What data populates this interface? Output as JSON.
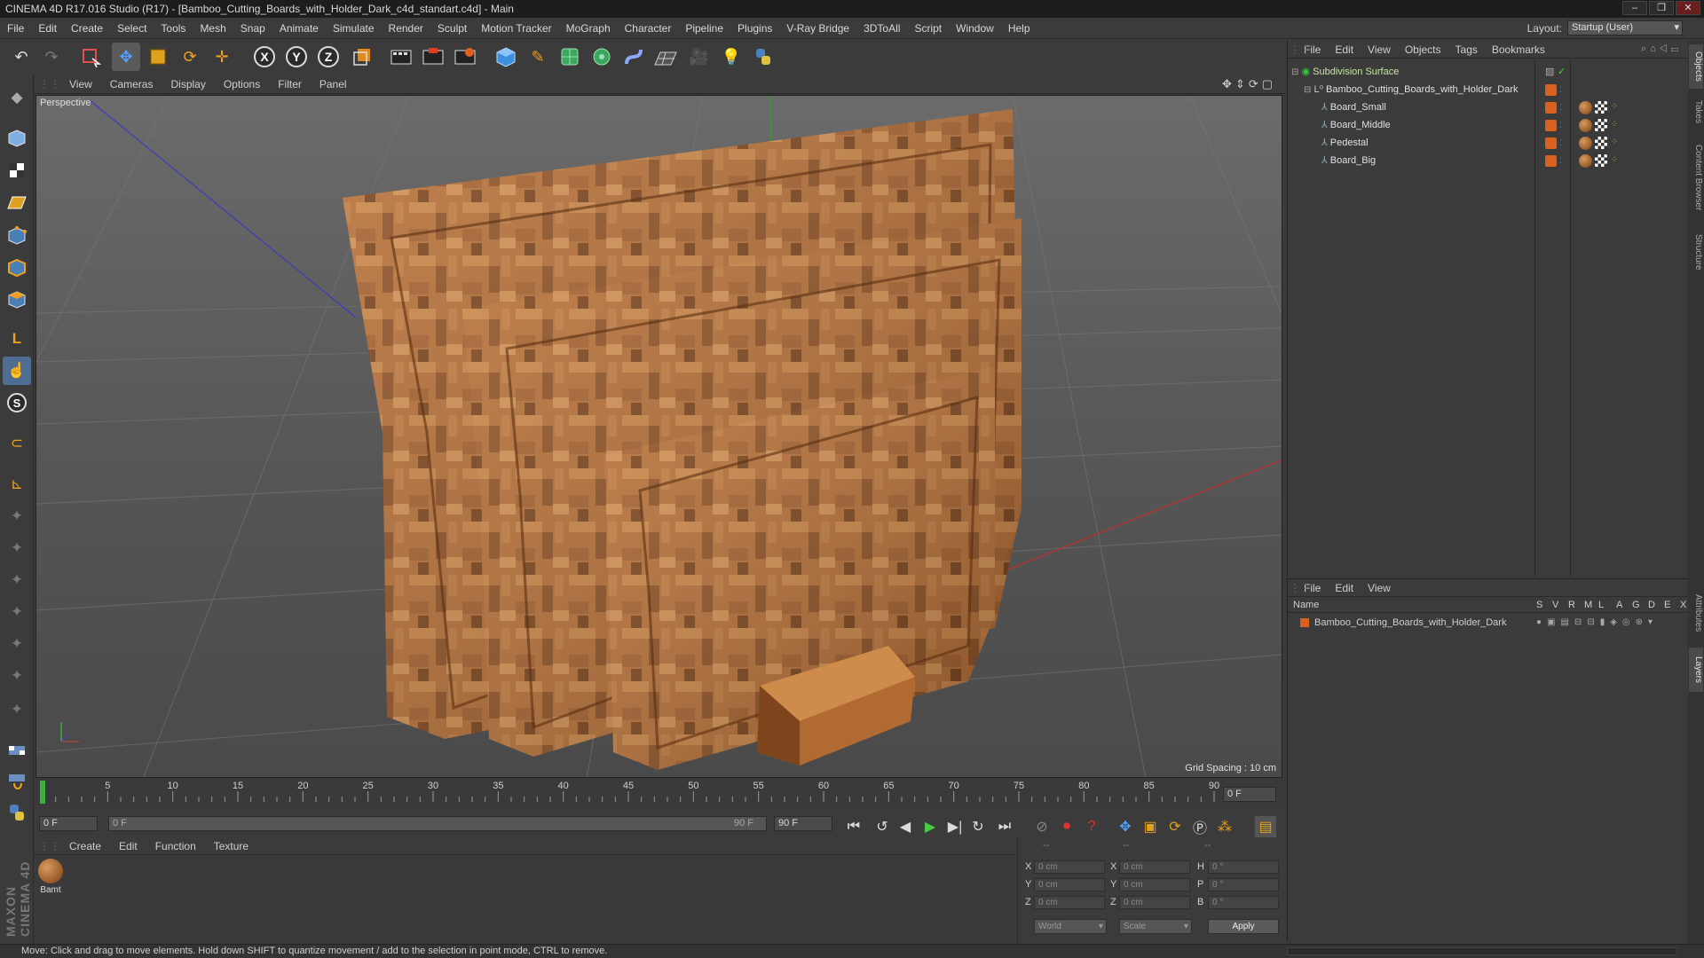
{
  "window": {
    "title": "CINEMA 4D R17.016 Studio (R17) - [Bamboo_Cutting_Boards_with_Holder_Dark_c4d_standart.c4d] - Main",
    "controls": [
      "–",
      "❐",
      "✕"
    ]
  },
  "menubar": {
    "items": [
      "File",
      "Edit",
      "Create",
      "Select",
      "Tools",
      "Mesh",
      "Snap",
      "Animate",
      "Simulate",
      "Render",
      "Sculpt",
      "Motion Tracker",
      "MoGraph",
      "Character",
      "Pipeline",
      "Plugins",
      "V-Ray Bridge",
      "3DToAll",
      "Script",
      "Window",
      "Help"
    ],
    "layout_label": "Layout:",
    "layout_value": "Startup (User)"
  },
  "toolbar": {
    "icons": [
      "undo-icon",
      "redo-icon",
      "live-selection-icon",
      "move-icon",
      "scale-icon",
      "rotate-icon",
      "transform-icon",
      "x-axis-icon",
      "y-axis-icon",
      "z-axis-icon",
      "coordinate-system-icon",
      "render-view-icon",
      "render-picture-viewer-icon",
      "edit-render-settings-icon",
      "cube-icon",
      "pen-icon",
      "subdivision-icon",
      "cloner-icon",
      "deformer-icon",
      "floor-icon",
      "camera-icon",
      "light-icon",
      "python-icon"
    ],
    "axis_labels": [
      "X",
      "Y",
      "Z"
    ]
  },
  "viewport": {
    "menu": [
      "View",
      "Cameras",
      "Display",
      "Options",
      "Filter",
      "Panel"
    ],
    "label": "Perspective",
    "grid_spacing": "Grid Spacing : 10 cm"
  },
  "timeline": {
    "ticks": [
      "0",
      "5",
      "10",
      "15",
      "20",
      "25",
      "30",
      "35",
      "40",
      "45",
      "50",
      "55",
      "60",
      "65",
      "70",
      "75",
      "80",
      "85",
      "90"
    ],
    "current_frame": "0 F",
    "start_field": "0 F",
    "range_start": "0 F",
    "range_end": "90 F",
    "end_field": "90 F"
  },
  "material_manager": {
    "menu": [
      "Create",
      "Edit",
      "Function",
      "Texture"
    ],
    "material_label": "Bamt"
  },
  "coordinates": {
    "headers": [
      "--",
      "--",
      "--"
    ],
    "rows": [
      {
        "a": "X",
        "av": "0 cm",
        "b": "X",
        "bv": "0 cm",
        "c": "H",
        "cv": "0 °"
      },
      {
        "a": "Y",
        "av": "0 cm",
        "b": "Y",
        "bv": "0 cm",
        "c": "P",
        "cv": "0 °"
      },
      {
        "a": "Z",
        "av": "0 cm",
        "b": "Z",
        "bv": "0 cm",
        "c": "B",
        "cv": "0 °"
      }
    ],
    "mode": "World",
    "scale": "Scale",
    "apply": "Apply"
  },
  "object_manager": {
    "menu": [
      "File",
      "Edit",
      "View",
      "Objects",
      "Tags",
      "Bookmarks"
    ],
    "objects": [
      {
        "name": "Subdivision Surface",
        "level": 0
      },
      {
        "name": "Bamboo_Cutting_Boards_with_Holder_Dark",
        "level": 1
      },
      {
        "name": "Board_Small",
        "level": 2
      },
      {
        "name": "Board_Middle",
        "level": 2
      },
      {
        "name": "Pedestal",
        "level": 2
      },
      {
        "name": "Board_Big",
        "level": 2
      }
    ]
  },
  "layer_manager": {
    "menu": [
      "File",
      "Edit",
      "View"
    ],
    "name_header": "Name",
    "columns": [
      "S",
      "V",
      "R",
      "M",
      "L",
      "A",
      "G",
      "D",
      "E",
      "X"
    ],
    "layers": [
      {
        "name": "Bamboo_Cutting_Boards_with_Holder_Dark",
        "color": "#d9601e"
      }
    ]
  },
  "side_tabs": [
    "Objects",
    "Takes",
    "Content Browser",
    "Structure",
    "Attributes",
    "Layers"
  ],
  "status": "Move: Click and drag to move elements. Hold down SHIFT to quantize movement / add to the selection in point mode, CTRL to remove.",
  "brand": "MAXON CINEMA 4D",
  "colors": {
    "accent": "#e08a1e",
    "selection": "#4d6d93",
    "wood": "#b8733a",
    "tag_orange": "#d9601e"
  }
}
